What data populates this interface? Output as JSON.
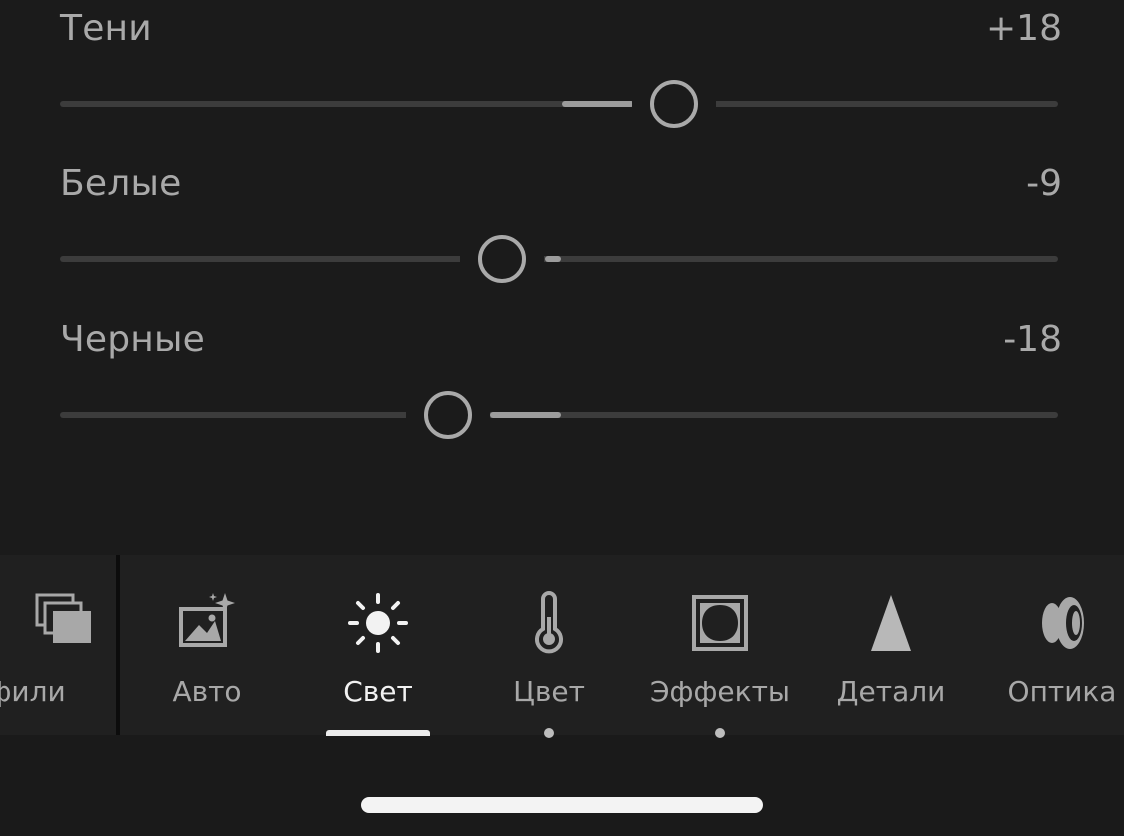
{
  "sliders": [
    {
      "label": "Тени",
      "value": "+18"
    },
    {
      "label": "Белые",
      "value": "-9"
    },
    {
      "label": "Черные",
      "value": "-18"
    }
  ],
  "toolbar": {
    "tools": [
      {
        "label": "офили",
        "icon": "profiles-icon"
      },
      {
        "label": "Авто",
        "icon": "auto-icon"
      },
      {
        "label": "Свет",
        "icon": "light-icon",
        "active": true
      },
      {
        "label": "Цвет",
        "icon": "color-temperature-icon",
        "has_edits": true
      },
      {
        "label": "Эффекты",
        "icon": "effects-icon",
        "has_edits": true
      },
      {
        "label": "Детали",
        "icon": "detail-icon"
      },
      {
        "label": "Оптика",
        "icon": "optics-icon"
      }
    ]
  },
  "colors": {
    "background": "#1b1b1b",
    "text": "#a9a9a9",
    "active_text": "#f2f2f2",
    "fill": "#9c9c9c"
  }
}
